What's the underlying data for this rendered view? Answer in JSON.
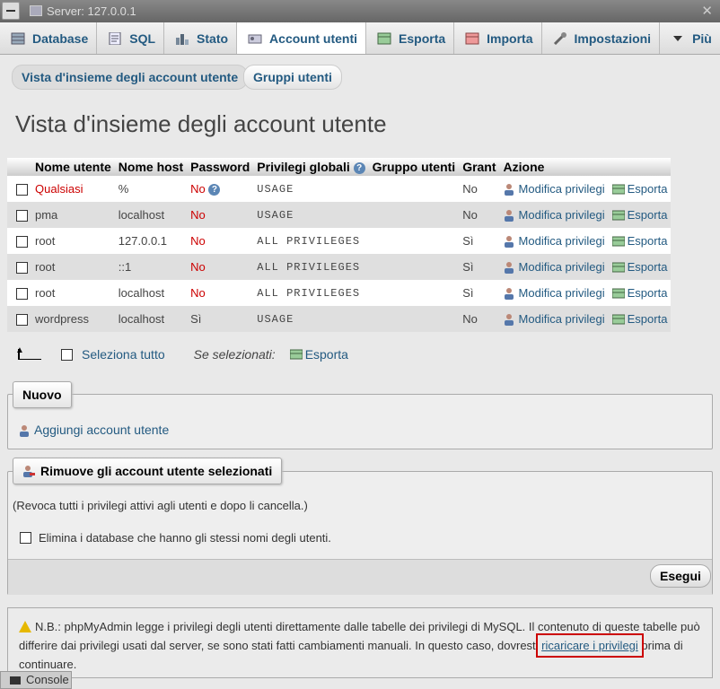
{
  "server_bar": {
    "title": "Server: 127.0.0.1"
  },
  "tabs": [
    {
      "label": "Database",
      "icon": "database-icon"
    },
    {
      "label": "SQL",
      "icon": "sql-icon"
    },
    {
      "label": "Stato",
      "icon": "status-icon"
    },
    {
      "label": "Account utenti",
      "icon": "user-accounts-icon",
      "active": true
    },
    {
      "label": "Esporta",
      "icon": "export-icon"
    },
    {
      "label": "Importa",
      "icon": "import-icon"
    },
    {
      "label": "Impostazioni",
      "icon": "wrench-icon"
    },
    {
      "label": "Più",
      "icon": "chevron-down-icon"
    }
  ],
  "subtabs": {
    "overview": "Vista d'insieme degli account utente",
    "groups": "Gruppi utenti"
  },
  "page_title": "Vista d'insieme degli account utente",
  "table": {
    "headers": [
      "Nome utente",
      "Nome host",
      "Password",
      "Privilegi globali",
      "Gruppo utenti",
      "Grant",
      "Azione"
    ],
    "rows": [
      {
        "user": "Qualsiasi",
        "host": "%",
        "password": "No",
        "privileges": "USAGE",
        "group": "",
        "grant": "No"
      },
      {
        "user": "pma",
        "host": "localhost",
        "password": "No",
        "privileges": "USAGE",
        "group": "",
        "grant": "No"
      },
      {
        "user": "root",
        "host": "127.0.0.1",
        "password": "No",
        "privileges": "ALL PRIVILEGES",
        "group": "",
        "grant": "Sì"
      },
      {
        "user": "root",
        "host": "::1",
        "password": "No",
        "privileges": "ALL PRIVILEGES",
        "group": "",
        "grant": "Sì"
      },
      {
        "user": "root",
        "host": "localhost",
        "password": "No",
        "privileges": "ALL PRIVILEGES",
        "group": "",
        "grant": "Sì"
      },
      {
        "user": "wordpress",
        "host": "localhost",
        "password": "Sì",
        "privileges": "USAGE",
        "group": "",
        "grant": "No"
      }
    ],
    "action_edit": "Modifica privilegi",
    "action_export": "Esporta"
  },
  "bulk": {
    "select_all": "Seleziona tutto",
    "with_selected": "Se selezionati:",
    "export": "Esporta"
  },
  "new_section": {
    "legend": "Nuovo",
    "add_user": "Aggiungi account utente"
  },
  "remove_section": {
    "legend": "Rimuove gli account utente selezionati",
    "description": "(Revoca tutti i privilegi attivi agli utenti e dopo li cancella.)",
    "drop_db_label": "Elimina i database che hanno gli stessi nomi degli utenti.",
    "go_button": "Esegui"
  },
  "note": {
    "text_before": "N.B.: phpMyAdmin legge i privilegi degli utenti direttamente dalle tabelle dei privilegi di MySQL. Il contenuto di queste tabelle può differire dai privilegi usati dal server, se sono stati fatti cambiamenti manuali. In questo caso, dovresti ",
    "link": "ricaricare i privilegi",
    "text_after": " prima di continuare."
  },
  "console": {
    "label": "Console"
  },
  "colors": {
    "link": "#235a81",
    "alert": "#cc0000",
    "row_alt": "#dfdfdf"
  }
}
